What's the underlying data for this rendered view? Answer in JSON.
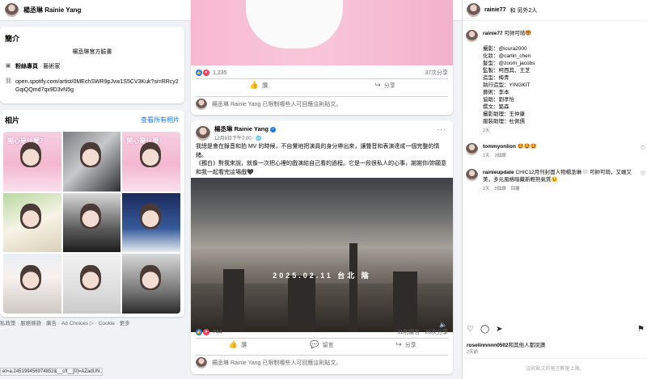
{
  "facebook": {
    "page_name": "楊丞琳 Rainie Yang",
    "more_label": "···",
    "intro": {
      "title": "簡介",
      "bio": "楊丞琳官方臉書",
      "category_prefix": "粉絲專頁",
      "category_value": " · 藝術家",
      "link": "open.spotify.com/artist/0MEchSWR9pJvw1S5CV3Kuk?si=RRcy2GqiQQmd7qx9D3vN5g"
    },
    "photos": {
      "title": "相片",
      "see_all": "查看所有相片",
      "tile_text_1": "開心是什麼？",
      "tile_text_3": "開心是什麼？"
    },
    "footer": "私政策 · 服務條款 · 廣告 · Ad Choices ▷ · Cookie · 更多",
    "status_url": "et=a.245199456974852&__cft__[0]=AZadUN...",
    "post1": {
      "reaction_count": "1,235",
      "comments": "37次分享",
      "like_label": "讚",
      "share_label": "分享",
      "restricted": "楊丞琳 Rainie Yang 已限制哪些人可回應這則貼文。"
    },
    "post2": {
      "author": "楊丞琳 Rainie Yang",
      "time": "12月8日下午7:00 · 🌐",
      "text_1": "我總是會在錄音和拍 MV 的時候，不自覺地把演員的身分帶出來，讓聲音和表演達成一個完整的情緒。",
      "text_2": "《獨白》對我來說，就像一次把心裡的戲演給自己看的過程。它是一段很私人的心事，謝謝你/妳願意和我一起看完這場戲🖤",
      "video_caption": "2025.02.11 台北 陰",
      "reaction_count": "744",
      "comments": "11則留言",
      "shares": "26次分享",
      "like_label": "讚",
      "comment_label": "留言",
      "share_label": "分享",
      "restricted": "楊丞琳 Rainie Yang 已限制哪些人可回應這則貼文。"
    }
  },
  "instagram": {
    "header_user": "rainie77",
    "header_suffix": "和 另外2人",
    "caption": {
      "user": "rainie77",
      "first_line": "可帥可萌🐯",
      "lines": [
        "攝影：@icura2000",
        "化妝：@carlin_chen",
        "髮型：@zoom_jacobs",
        "監製：柯西其、王芝",
        "造型：梅青",
        "執行造型：YINGKIT",
        "藝術：李本",
        "協助：劉孝怡",
        "撰文：築森",
        "攝影助理：王仲康",
        "服裝助理：杜佩儒"
      ],
      "age": "2天"
    },
    "comment1": {
      "user": "tommyonlion",
      "text": "🤩🤩🤩",
      "age": "1天",
      "likes": "2個讚"
    },
    "comment2": {
      "user": "rainieupdate",
      "text": "CHIC12月刊封面人物楊丞琳🤍 可帥可萌，又颯又美，多元風格暗藏新輕熟氣質😉",
      "age": "2天",
      "likes": "5個讚",
      "reply": "回覆"
    },
    "likes_user": "roselinnnnn0502",
    "likes_suffix": "和其他人都說讚",
    "date": "2天前",
    "limited": "這則貼文的留言數量上限。"
  }
}
